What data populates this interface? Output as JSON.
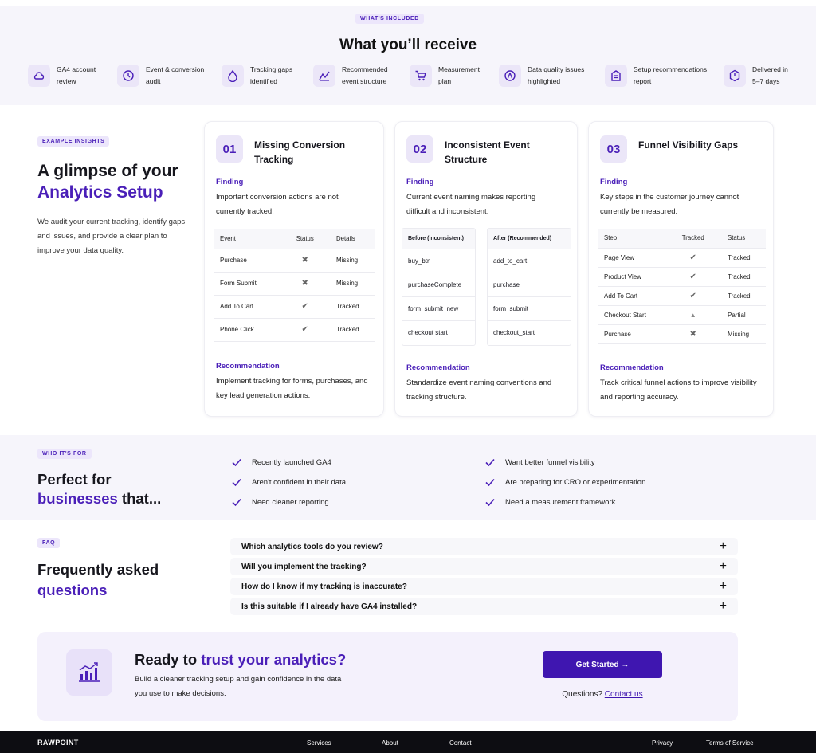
{
  "included": {
    "tag": "What's included",
    "title": "What you’ll receive",
    "items": [
      {
        "line1": "GA4 account",
        "line2": "review",
        "icon": "ga4-icon"
      },
      {
        "line1": "Event & conversion",
        "line2": "audit",
        "icon": "clock-icon"
      },
      {
        "line1": "Tracking gaps",
        "line2": "identified",
        "icon": "droplet-icon"
      },
      {
        "line1": "Recommended",
        "line2": "event structure",
        "icon": "chart-line-icon"
      },
      {
        "line1": "Measurement",
        "line2": "plan",
        "icon": "cart-icon"
      },
      {
        "line1": "Data quality issues",
        "line2": "highlighted",
        "icon": "warning-icon"
      },
      {
        "line1": "Setup recommendations",
        "line2": "report",
        "icon": "report-icon"
      },
      {
        "line1": "Delivered in",
        "line2": "5–7 days",
        "icon": "calendar-icon"
      }
    ]
  },
  "insights": {
    "tag": "Example insights",
    "title_part1": "A glimpse of your",
    "title_part2": "Analytics Setup",
    "description": "We audit your current tracking, identify gaps and issues, and provide a clear plan to improve your data quality.",
    "cards": [
      {
        "num": "01",
        "title": "Missing Conversion Tracking",
        "finding_label": "Finding",
        "finding": "Important conversion actions are not currently tracked.",
        "table_headers": [
          "Event",
          "Status",
          "Details"
        ],
        "rows": [
          {
            "event": "Purchase",
            "status": "✖",
            "details": "Missing"
          },
          {
            "event": "Form Submit",
            "status": "✖",
            "details": "Missing"
          },
          {
            "event": "Add To Cart",
            "status": "✔",
            "details": "Tracked"
          },
          {
            "event": "Phone Click",
            "status": "✔",
            "details": "Tracked"
          }
        ],
        "rec_label": "Recommendation",
        "recommendation": "Implement tracking for forms, purchases, and key lead generation actions."
      },
      {
        "num": "02",
        "title": "Inconsistent Event Structure",
        "finding_label": "Finding",
        "finding": "Current event naming makes reporting difficult and inconsistent.",
        "before_header": "Before (Inconsistent)",
        "after_header": "After (Recommended)",
        "before": [
          "buy_btn",
          "purchaseComplete",
          "form_submit_new",
          "checkout start"
        ],
        "after": [
          "add_to_cart",
          "purchase",
          "form_submit",
          "checkout_start"
        ],
        "rec_label": "Recommendation",
        "recommendation": "Standardize event naming conventions and tracking structure."
      },
      {
        "num": "03",
        "title": "Funnel Visibility Gaps",
        "finding_label": "Finding",
        "finding": "Key steps in the customer journey cannot currently be measured.",
        "table_headers": [
          "Step",
          "Tracked",
          "Status"
        ],
        "rows": [
          {
            "step": "Page View",
            "tracked": "✔",
            "status": "Tracked"
          },
          {
            "step": "Product View",
            "tracked": "✔",
            "status": "Tracked"
          },
          {
            "step": "Add To Cart",
            "tracked": "✔",
            "status": "Tracked"
          },
          {
            "step": "Checkout Start",
            "tracked": "▲",
            "status": "Partial"
          },
          {
            "step": "Purchase",
            "tracked": "✖",
            "status": "Missing"
          }
        ],
        "rec_label": "Recommendation",
        "recommendation": "Track critical funnel actions to improve visibility and reporting accuracy."
      }
    ]
  },
  "who": {
    "tag": "Who it's for",
    "title_part1": "Perfect for",
    "title_part2": "businesses",
    "title_part3": " that...",
    "left": [
      "Recently launched GA4",
      "Aren't confident in their data",
      "Need cleaner reporting"
    ],
    "right": [
      "Want better funnel visibility",
      "Are preparing for CRO or experimentation",
      "Need a measurement framework"
    ]
  },
  "faq": {
    "tag": "FAQ",
    "title_part1": "Frequently asked",
    "title_part2": "questions",
    "items": [
      "Which analytics tools do you review?",
      "Will you implement the tracking?",
      "How do I know if my tracking is inaccurate?",
      "Is this suitable if I already have GA4 installed?"
    ],
    "expand_symbol": "+"
  },
  "cta": {
    "title_part1": "Ready to ",
    "title_part2": "trust your analytics?",
    "description": "Build a cleaner tracking setup and gain confidence in the data you use to make decisions.",
    "button": "Get Started →",
    "question": "Questions? ",
    "contact_link": "Contact us"
  },
  "footer": {
    "brand": "RAWPOINT",
    "links": [
      "Services",
      "About",
      "Contact"
    ],
    "legal": [
      "Privacy",
      "Terms of Service"
    ]
  },
  "colors": {
    "accent": "#4a1fb8",
    "button": "#3f16b0",
    "section_bg": "#f6f5fb",
    "footer_bg": "#0d0d12"
  }
}
